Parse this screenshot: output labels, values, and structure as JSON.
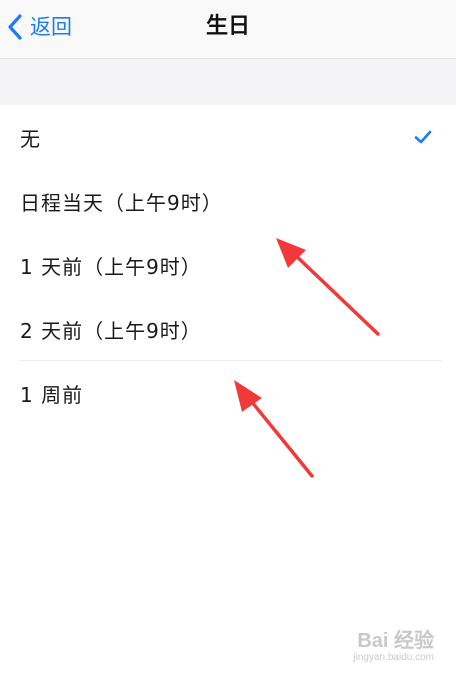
{
  "navbar": {
    "back_label": "返回",
    "title": "生日"
  },
  "options": [
    {
      "label": "无",
      "selected": true
    },
    {
      "label": "日程当天（上午9时）",
      "selected": false
    },
    {
      "label": "1 天前（上午9时）",
      "selected": false
    },
    {
      "label": "2 天前（上午9时）",
      "selected": false
    },
    {
      "label": "1 周前",
      "selected": false
    }
  ],
  "colors": {
    "accent": "#1d7bf5",
    "annotation_arrow": "#f03a3a"
  },
  "watermark": {
    "main": "Bai 经验",
    "sub": "jingyan.baidu.com"
  }
}
